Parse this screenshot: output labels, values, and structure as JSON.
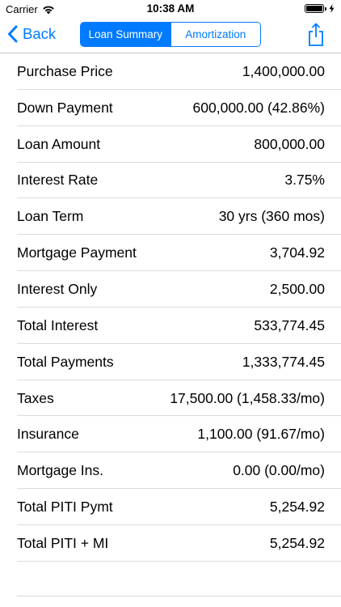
{
  "status_bar": {
    "carrier": "Carrier",
    "time": "10:38 AM",
    "icons": [
      "wifi-icon",
      "battery-icon",
      "charging-bolt-icon"
    ]
  },
  "nav": {
    "back_label": "Back",
    "back_icon": "chevron-left-icon",
    "share_icon": "share-icon",
    "accent_color": "#007aff",
    "segments": [
      {
        "label": "Loan Summary",
        "selected": true
      },
      {
        "label": "Amortization",
        "selected": false
      }
    ]
  },
  "rows": [
    {
      "label": "Purchase Price",
      "value": "1,400,000.00"
    },
    {
      "label": "Down Payment",
      "value": "600,000.00 (42.86%)"
    },
    {
      "label": "Loan Amount",
      "value": "800,000.00"
    },
    {
      "label": "Interest Rate",
      "value": "3.75%"
    },
    {
      "label": "Loan Term",
      "value": "30 yrs (360 mos)"
    },
    {
      "label": "Mortgage Payment",
      "value": "3,704.92"
    },
    {
      "label": "Interest Only",
      "value": "2,500.00"
    },
    {
      "label": "Total Interest",
      "value": "533,774.45"
    },
    {
      "label": "Total Payments",
      "value": "1,333,774.45"
    },
    {
      "label": "Taxes",
      "value": "17,500.00 (1,458.33/mo)"
    },
    {
      "label": "Insurance",
      "value": "1,100.00 (91.67/mo)"
    },
    {
      "label": "Mortgage Ins.",
      "value": "0.00 (0.00/mo)"
    },
    {
      "label": "Total PITI Pymt",
      "value": "5,254.92"
    },
    {
      "label": "Total PITI + MI",
      "value": "5,254.92"
    }
  ]
}
